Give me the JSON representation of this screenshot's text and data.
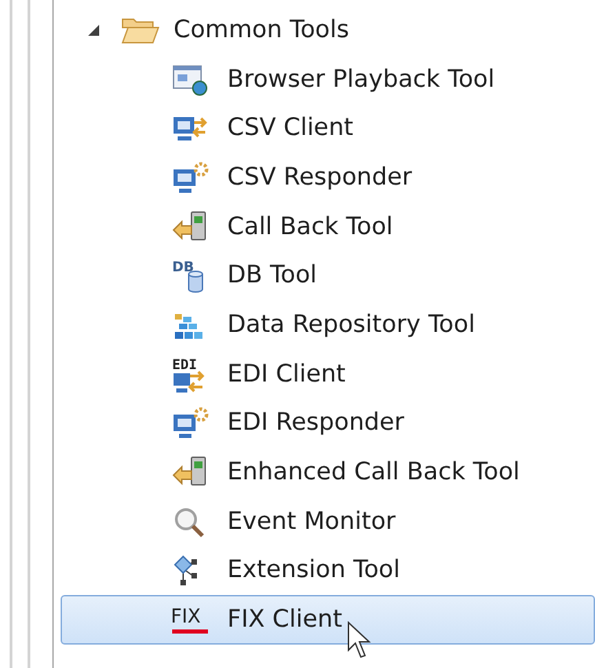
{
  "tree": {
    "label": "Common Tools",
    "expanded": true,
    "children": [
      {
        "label": "Browser Playback Tool",
        "kind": "browser",
        "selected": false
      },
      {
        "label": "CSV Client",
        "kind": "client",
        "selected": false
      },
      {
        "label": "CSV Responder",
        "kind": "responder",
        "selected": false
      },
      {
        "label": "Call Back Tool",
        "kind": "callback",
        "selected": false
      },
      {
        "label": "DB Tool",
        "kind": "db",
        "icon_text": "DB",
        "selected": false
      },
      {
        "label": "Data Repository Tool",
        "kind": "repository",
        "selected": false
      },
      {
        "label": "EDI Client",
        "kind": "edi",
        "icon_text": "EDI",
        "selected": false
      },
      {
        "label": "EDI Responder",
        "kind": "responder",
        "selected": false
      },
      {
        "label": "Enhanced Call Back Tool",
        "kind": "callback",
        "selected": false
      },
      {
        "label": "Event Monitor",
        "kind": "monitor",
        "selected": false
      },
      {
        "label": "Extension Tool",
        "kind": "extension",
        "selected": false
      },
      {
        "label": "FIX Client",
        "kind": "fix",
        "icon_text": "FIX",
        "selected": true
      }
    ]
  }
}
